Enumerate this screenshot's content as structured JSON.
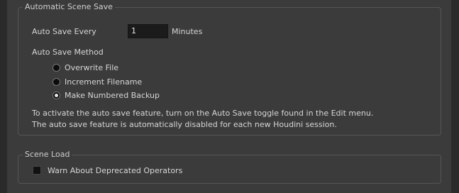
{
  "auto_save": {
    "group_title": "Automatic Scene Save",
    "every_label": "Auto Save Every",
    "every_value": "1",
    "unit_label": "Minutes",
    "method_label": "Auto Save Method",
    "methods": [
      {
        "label": "Overwrite File",
        "checked": false
      },
      {
        "label": "Increment Filename",
        "checked": false
      },
      {
        "label": "Make Numbered Backup",
        "checked": true
      }
    ],
    "help_line1": "To activate the auto save feature, turn on the Auto Save toggle found in the Edit menu.",
    "help_line2": "The auto save feature is automatically disabled for each new Houdini session."
  },
  "scene_load": {
    "group_title": "Scene Load",
    "warn_label": "Warn About Deprecated Operators",
    "warn_checked": false
  }
}
